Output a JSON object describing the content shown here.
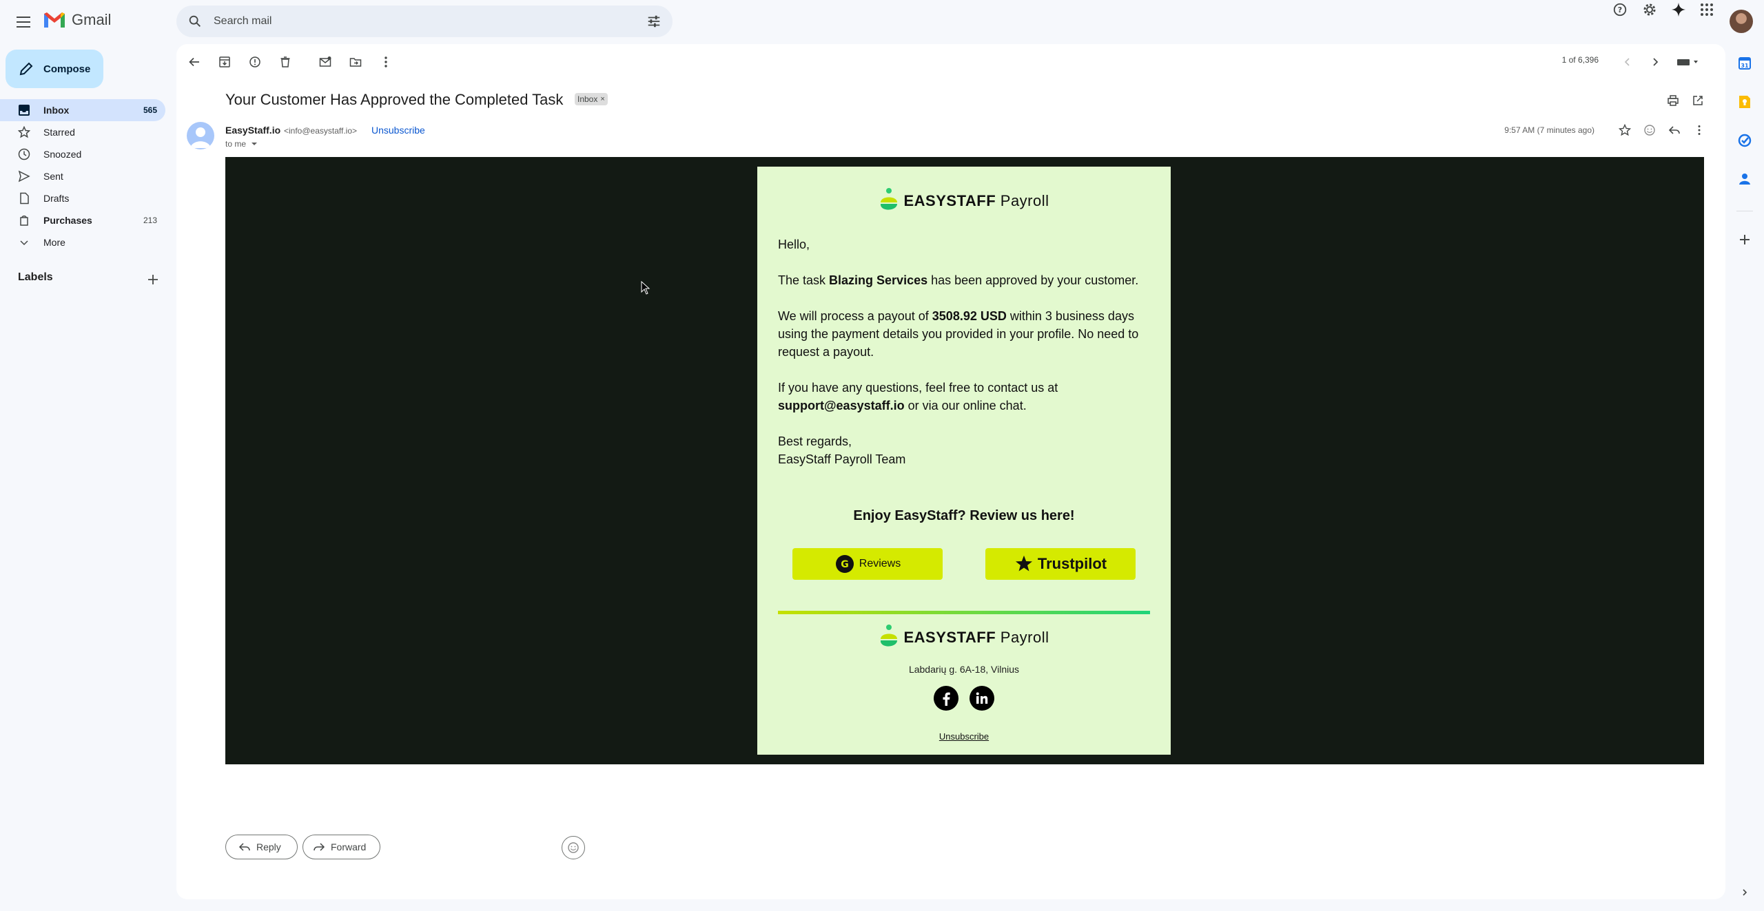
{
  "app": {
    "name": "Gmail"
  },
  "search": {
    "placeholder": "Search mail"
  },
  "compose": {
    "label": "Compose"
  },
  "nav": [
    {
      "label": "Inbox",
      "count": "565",
      "icon": "inbox-icon"
    },
    {
      "label": "Starred",
      "count": "",
      "icon": "star-icon"
    },
    {
      "label": "Snoozed",
      "count": "",
      "icon": "clock-icon"
    },
    {
      "label": "Sent",
      "count": "",
      "icon": "send-icon"
    },
    {
      "label": "Drafts",
      "count": "",
      "icon": "draft-icon"
    },
    {
      "label": "Purchases",
      "count": "213",
      "icon": "tag-icon"
    },
    {
      "label": "More",
      "count": "",
      "icon": "chevron-down-icon"
    }
  ],
  "labels": {
    "heading": "Labels"
  },
  "toolbar": {
    "pager": "1 of 6,396"
  },
  "message": {
    "subject": "Your Customer Has Approved the Completed Task",
    "chip": "Inbox",
    "sender_name": "EasyStaff.io",
    "sender_email": "<info@easystaff.io>",
    "unsubscribe": "Unsubscribe",
    "to": "to me",
    "time": "9:57 AM (7 minutes ago)"
  },
  "email": {
    "brand_name": "EASYSTAFF",
    "brand_suffix": "Payroll",
    "greeting": "Hello,",
    "p1_a": "The task ",
    "p1_b": "Blazing Services",
    "p1_c": " has been approved by your customer.",
    "p2_a": "We will process a payout of ",
    "p2_b": "3508.92 USD",
    "p2_c": " within 3 business days using the payment details you provided in your profile. No need to request a payout.",
    "p3_a": "If you have any questions, feel free to contact us at ",
    "p3_b": "support@easystaff.io",
    "p3_c": " or via our online chat.",
    "sign1": "Best regards,",
    "sign2": "EasyStaff Payroll Team",
    "review_title": "Enjoy EasyStaff? Review us here!",
    "g2_label": "Reviews",
    "tp_label": "Trustpilot",
    "address": "Labdarių g. 6A-18, Vilnius",
    "footer_unsub": "Unsubscribe"
  },
  "actions": {
    "reply": "Reply",
    "forward": "Forward"
  },
  "colors": {
    "accent": "#c2e7ff",
    "email_bg": "#131a14",
    "card_bg": "#e3f9cf",
    "button": "#d5ea00"
  }
}
